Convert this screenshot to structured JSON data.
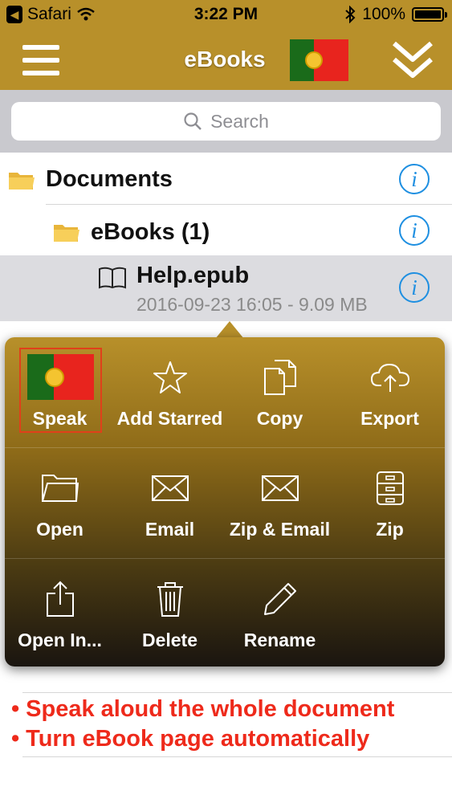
{
  "status": {
    "carrier_back": "Safari",
    "time": "3:22 PM",
    "battery": "100%"
  },
  "nav": {
    "title": "eBooks"
  },
  "search": {
    "placeholder": "Search"
  },
  "tree": {
    "documents": {
      "label": "Documents"
    },
    "ebooks": {
      "label": "eBooks (1)"
    },
    "file": {
      "name": "Help.epub",
      "meta": "2016-09-23 16:05 - 9.09 MB"
    }
  },
  "actions": [
    {
      "label": "Speak",
      "icon": "portugal-flag-icon"
    },
    {
      "label": "Add Starred",
      "icon": "star-icon"
    },
    {
      "label": "Copy",
      "icon": "copy-icon"
    },
    {
      "label": "Export",
      "icon": "cloud-upload-icon"
    },
    {
      "label": "Open",
      "icon": "folder-icon"
    },
    {
      "label": "Email",
      "icon": "envelope-icon"
    },
    {
      "label": "Zip & Email",
      "icon": "envelope-icon"
    },
    {
      "label": "Zip",
      "icon": "zip-cabinet-icon"
    },
    {
      "label": "Open In...",
      "icon": "share-icon"
    },
    {
      "label": "Delete",
      "icon": "trash-icon"
    },
    {
      "label": "Rename",
      "icon": "pencil-icon"
    }
  ],
  "promo": [
    "Speak aloud the whole document",
    "Turn eBook page automatically"
  ],
  "colors": {
    "gold": "#b8902a",
    "info_blue": "#1e8fe1",
    "promo_red": "#ee2a1b"
  }
}
